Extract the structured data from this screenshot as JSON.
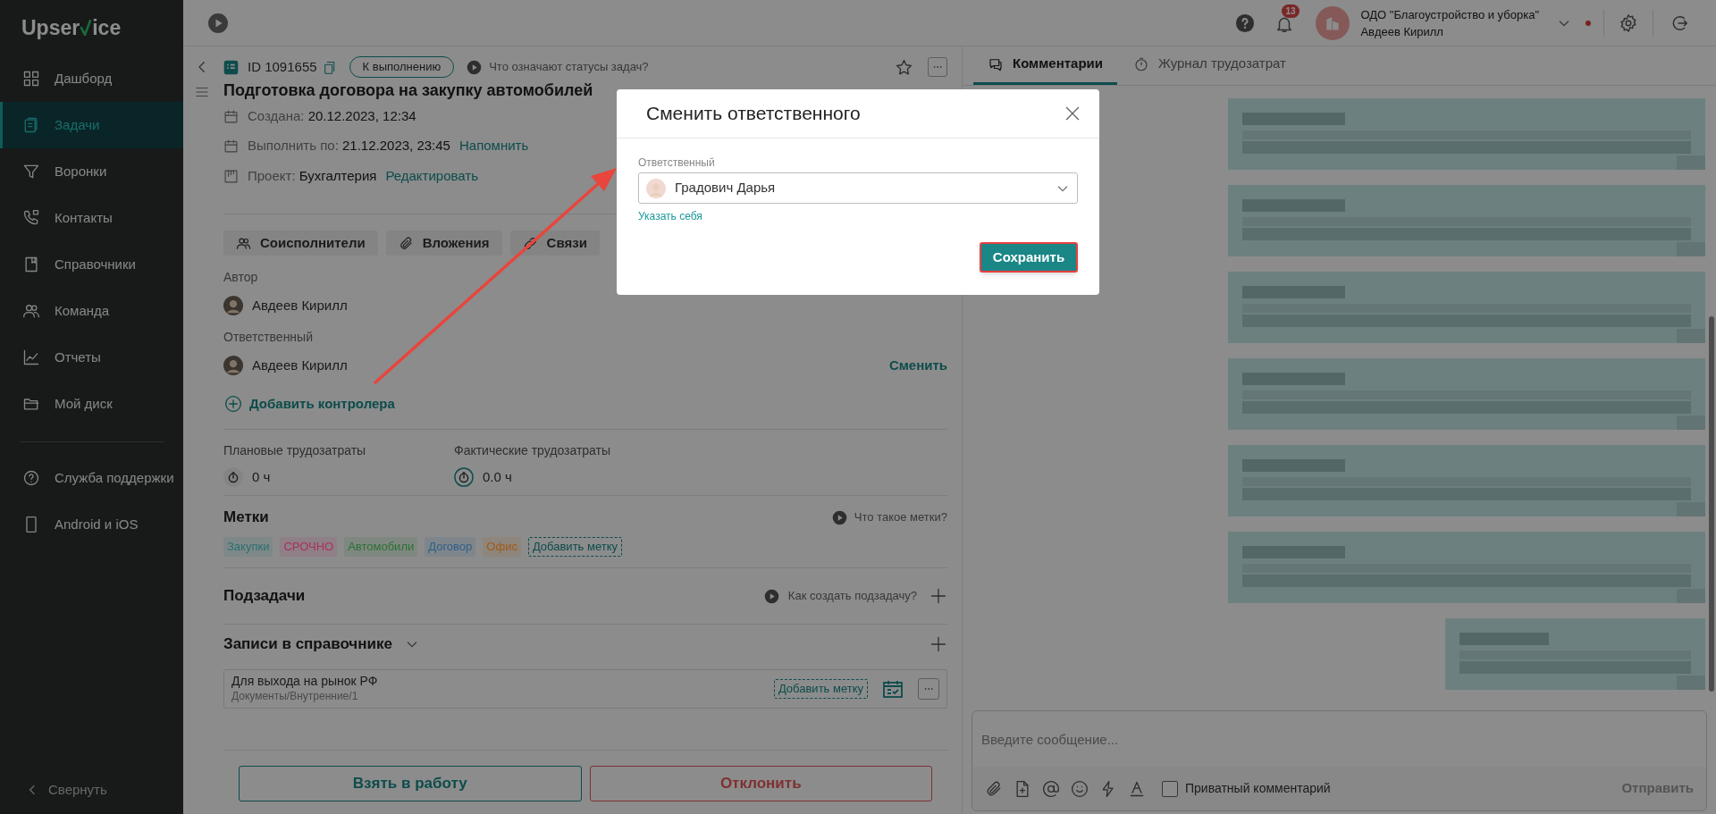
{
  "sidebar": {
    "logo": {
      "before": "Upser",
      "after": "ice"
    },
    "items": [
      {
        "label": "Дашборд",
        "selected": false
      },
      {
        "label": "Задачи",
        "selected": true
      },
      {
        "label": "Воронки",
        "selected": false
      },
      {
        "label": "Контакты",
        "selected": false
      },
      {
        "label": "Справочники",
        "selected": false
      },
      {
        "label": "Команда",
        "selected": false
      },
      {
        "label": "Отчеты",
        "selected": false
      },
      {
        "label": "Мой диск",
        "selected": false
      }
    ],
    "support_items": [
      {
        "label": "Служба поддержки"
      },
      {
        "label": "Android и iOS"
      }
    ],
    "collapse": "Свернуть"
  },
  "header": {
    "notifications": "13",
    "organization": "ОДО \"Благоустройство и уборка\"",
    "user": "Авдеев Кирилл"
  },
  "task": {
    "id": "ID 1091655",
    "status": "К выполнению",
    "status_help": "Что означают статусы задач?",
    "title": "Подготовка договора на закупку автомобилей",
    "dates": [
      {
        "label": "Создана:",
        "value": "20.12.2023, 12:34"
      },
      {
        "label": "Выполнить по:",
        "value": "21.12.2023, 23:45",
        "link": "Напомнить"
      },
      {
        "label": "Проект:",
        "value": "Бухгалтерия",
        "link": "Редактировать"
      }
    ],
    "section_buttons": [
      "Соисполнители",
      "Вложения",
      "Связи"
    ],
    "author_label": "Автор",
    "author": "Авдеев Кирилл",
    "assignee_label": "Ответственный",
    "assignee": "Авдеев Кирилл",
    "change_link": "Сменить",
    "add_controller": "Добавить контролера",
    "efforts": [
      {
        "label": "Плановые трудозатраты",
        "value": "0 ч"
      },
      {
        "label": "Фактические трудозатраты",
        "value": "0.0 ч"
      }
    ],
    "tags_title": "Метки",
    "tags_help": "Что такое метки?",
    "tags": [
      {
        "label": "Закупки",
        "color": "#2a7070"
      },
      {
        "label": "СРОЧНО",
        "color": "#a8305f"
      },
      {
        "label": "Автомобили",
        "color": "#2a7034"
      },
      {
        "label": "Договор",
        "color": "#2e5f88"
      },
      {
        "label": "Офис",
        "color": "#a05a14"
      }
    ],
    "add_tag": "Добавить метку",
    "subtasks_title": "Подзадачи",
    "subtasks_help": "Как создать подзадачу?",
    "directory_title": "Записи в справочнике",
    "record": {
      "title": "Для выхода на рынок РФ",
      "path": "Документы/Внутренние/1",
      "add_tag": "Добавить метку"
    },
    "actions": [
      "Взять в работу",
      "Отклонить"
    ]
  },
  "comments_panel": {
    "tabs": [
      {
        "label": "Комментарии",
        "selected": true
      },
      {
        "label": "Журнал трудозатрат",
        "selected": false
      }
    ],
    "messages": [
      {
        "kind": "picture"
      },
      {
        "kind": "picture"
      },
      {
        "kind": "picture"
      },
      {
        "kind": "picture"
      },
      {
        "kind": "picture"
      },
      {
        "kind": "picture"
      },
      {
        "kind": "picture",
        "narrow": true
      }
    ],
    "composer": {
      "placeholder": "Введите сообщение...",
      "private_label": "Приватный комментарий",
      "private_checked": false,
      "send": "Отправить"
    }
  },
  "modal": {
    "title": "Сменить ответственного",
    "field_label": "Ответственный",
    "value": "Градович Дарья",
    "self_link": "Указать себя",
    "save": "Сохранить"
  }
}
